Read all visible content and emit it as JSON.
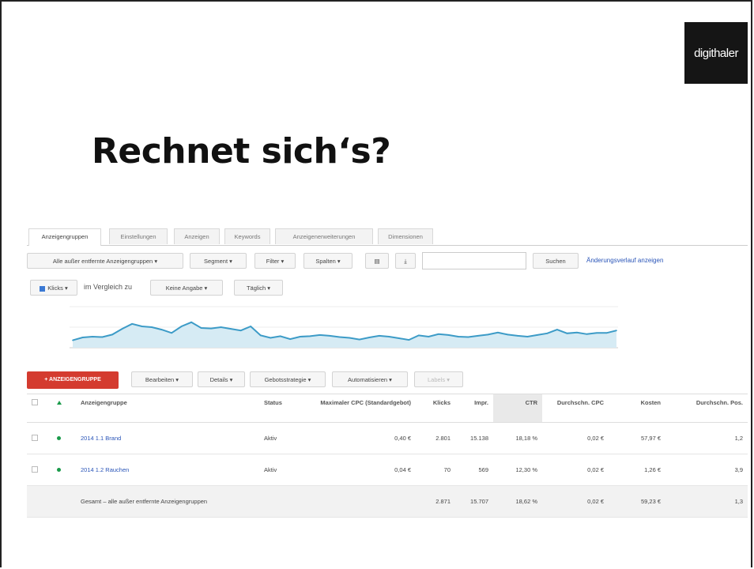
{
  "slide": {
    "title": "Rechnet sich‘s?",
    "logo": "digithaler"
  },
  "tabs": [
    "Anzeigengruppen",
    "Einstellungen",
    "Anzeigen",
    "Keywords",
    "Anzeigenerweiterungen",
    "Dimensionen"
  ],
  "toolbar": {
    "filter_select": "Alle außer entfernte Anzeigengruppen",
    "segment": "Segment",
    "filter": "Filter",
    "columns": "Spalten",
    "search_button": "Suchen",
    "history_link": "Änderungsverlauf anzeigen"
  },
  "chart_controls": {
    "metric": "Klicks",
    "compare_label": "im Vergleich zu",
    "compare_select": "Keine Angabe",
    "period_select": "Täglich"
  },
  "chart_data": {
    "type": "area",
    "title": "",
    "xlabel": "",
    "ylabel": "",
    "series": [
      {
        "name": "Klicks",
        "values": [
          18,
          25,
          27,
          26,
          32,
          46,
          58,
          52,
          50,
          44,
          36,
          52,
          62,
          48,
          47,
          50,
          46,
          42,
          52,
          30,
          24,
          28,
          21,
          27,
          28,
          31,
          29,
          26,
          24,
          20,
          25,
          29,
          27,
          23,
          19,
          30,
          27,
          33,
          31,
          27,
          26,
          29,
          32,
          37,
          32,
          29,
          27,
          31,
          35,
          44,
          35,
          37,
          33,
          36,
          36,
          42
        ]
      }
    ],
    "ylim": [
      0,
      100
    ],
    "colors": {
      "line": "#3c9bc7",
      "fill": "#d6ebf4"
    }
  },
  "actions": {
    "add_group": "+ ANZEIGENGRUPPE",
    "edit": "Bearbeiten",
    "details": "Details",
    "bid_strategy": "Gebotsstrategie",
    "automate": "Automatisieren",
    "labels": "Labels"
  },
  "table": {
    "headers": [
      "Anzeigengruppe",
      "Status",
      "Maximaler CPC (Standardgebot)",
      "Klicks",
      "Impr.",
      "CTR",
      "Durchschn. CPC",
      "Kosten",
      "Durchschn. Pos."
    ],
    "rows": [
      {
        "name": "2014 1.1 Brand",
        "status": "Aktiv",
        "max_cpc": "0,40 €",
        "clicks": "2.801",
        "impr": "15.138",
        "ctr": "18,18 %",
        "avg_cpc": "0,02 €",
        "cost": "57,97 €",
        "pos": "1,2"
      },
      {
        "name": "2014 1.2 Rauchen",
        "status": "Aktiv",
        "max_cpc": "0,04 €",
        "clicks": "70",
        "impr": "569",
        "ctr": "12,30 %",
        "avg_cpc": "0,02 €",
        "cost": "1,26 €",
        "pos": "3,9"
      }
    ],
    "total": {
      "label": "Gesamt – alle außer entfernte Anzeigengruppen",
      "clicks": "2.871",
      "impr": "15.707",
      "ctr": "18,62 %",
      "avg_cpc": "0,02 €",
      "cost": "59,23 €",
      "pos": "1,3"
    }
  }
}
